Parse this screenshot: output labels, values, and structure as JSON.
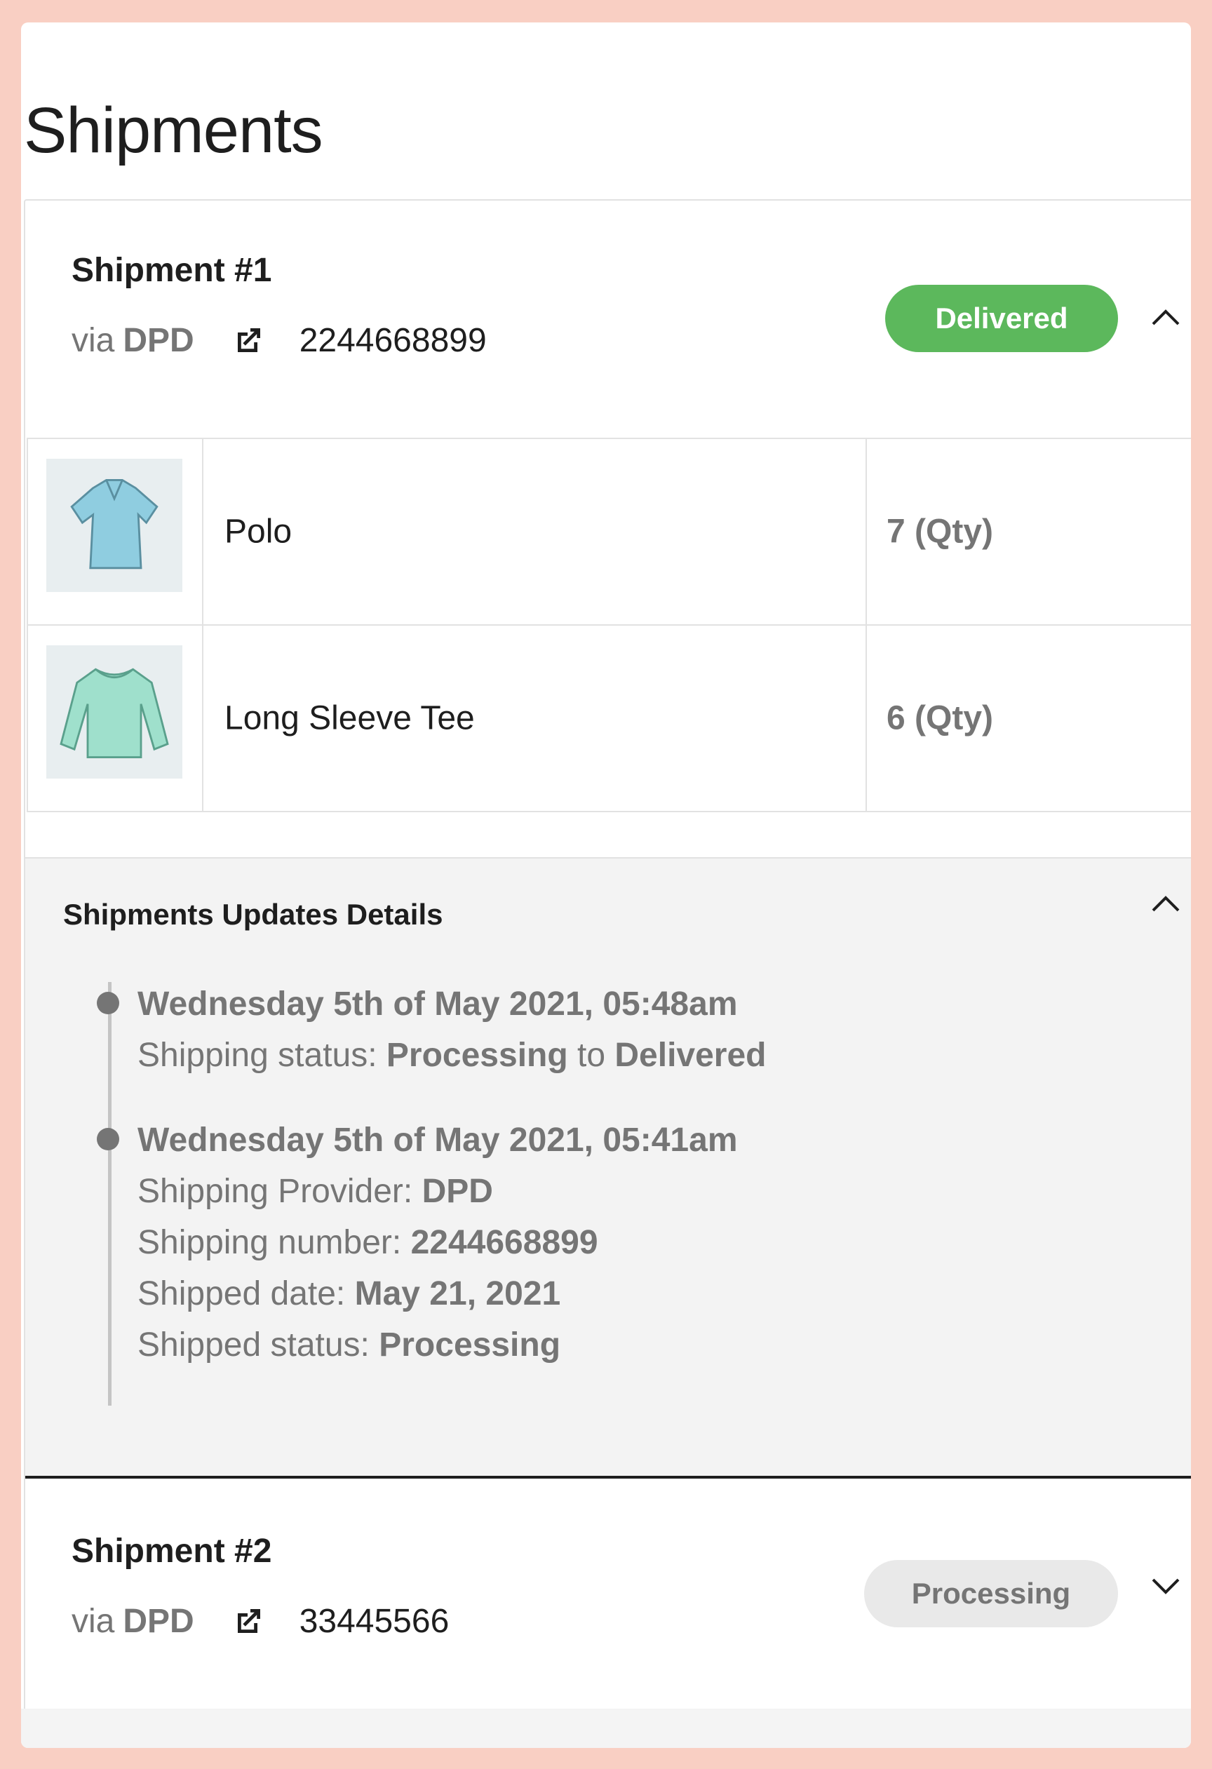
{
  "page": {
    "title": "Shipments"
  },
  "shipments": [
    {
      "title": "Shipment #1",
      "via_prefix": "via",
      "carrier": "DPD",
      "tracking": "2244668899",
      "status": "Delivered",
      "status_color": "#5cb85c",
      "expanded": true,
      "items": [
        {
          "name": "Polo",
          "qty": "7 (Qty)",
          "image_icon": "polo-shirt-icon"
        },
        {
          "name": "Long Sleeve Tee",
          "qty": "6 (Qty)",
          "image_icon": "long-sleeve-tee-icon"
        }
      ],
      "updates": {
        "title": "Shipments Updates Details",
        "events": [
          {
            "date": "Wednesday 5th of May 2021, 05:48am",
            "lines": [
              {
                "label": "Shipping status: ",
                "value": "Processing",
                "mid": " to ",
                "value2": "Delivered"
              }
            ]
          },
          {
            "date": "Wednesday 5th of May 2021, 05:41am",
            "lines": [
              {
                "label": "Shipping Provider: ",
                "value": "DPD"
              },
              {
                "label": "Shipping number: ",
                "value": "2244668899"
              },
              {
                "label": "Shipped date: ",
                "value": "May 21, 2021"
              },
              {
                "label": "Shipped status: ",
                "value": "Processing"
              }
            ]
          }
        ]
      }
    },
    {
      "title": "Shipment #2",
      "via_prefix": "via",
      "carrier": "DPD",
      "tracking": "33445566",
      "status": "Processing",
      "status_color": "#e9e9e9",
      "expanded": false
    }
  ]
}
